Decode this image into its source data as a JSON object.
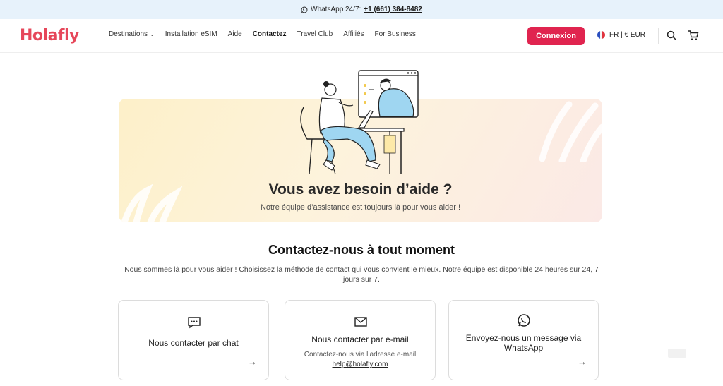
{
  "topbar": {
    "label": "WhatsApp 24/7:",
    "phone": "+1 (661) 384-8482"
  },
  "header": {
    "logo": "Holafly",
    "nav": [
      {
        "label": "Destinations",
        "has_dropdown": true
      },
      {
        "label": "Installation eSIM"
      },
      {
        "label": "Aide"
      },
      {
        "label": "Contactez",
        "active": true
      },
      {
        "label": "Travel Club"
      },
      {
        "label": "Affiliés"
      },
      {
        "label": "For Business"
      }
    ],
    "login_label": "Connexion",
    "language": "FR | € EUR",
    "icons": [
      "search-icon",
      "cart-icon",
      "france-flag-icon"
    ]
  },
  "hero": {
    "title": "Vous avez besoin d’aide ?",
    "subtitle": "Notre équipe d’assistance est toujours là pour vous aider !"
  },
  "contact": {
    "title": "Contactez-nous à tout moment",
    "text": "Nous sommes là pour vous aider ! Choisissez la méthode de contact qui vous convient le mieux. Notre équipe est disponible 24 heures sur 24, 7 jours sur 7.",
    "cards": [
      {
        "title": "Nous contacter par chat",
        "icon": "chat-icon"
      },
      {
        "title": "Nous contacter par e-mail",
        "subtitle": "Contactez-nous via l’adresse e-mail",
        "email": "help@holafly.com",
        "icon": "mail-icon"
      },
      {
        "title": "Envoyez-nous un message via WhatsApp",
        "icon": "whatsapp-icon"
      }
    ]
  },
  "colors": {
    "brand": "#e6475a",
    "button": "#e0244f",
    "topbar_bg": "#e7f2fb"
  }
}
